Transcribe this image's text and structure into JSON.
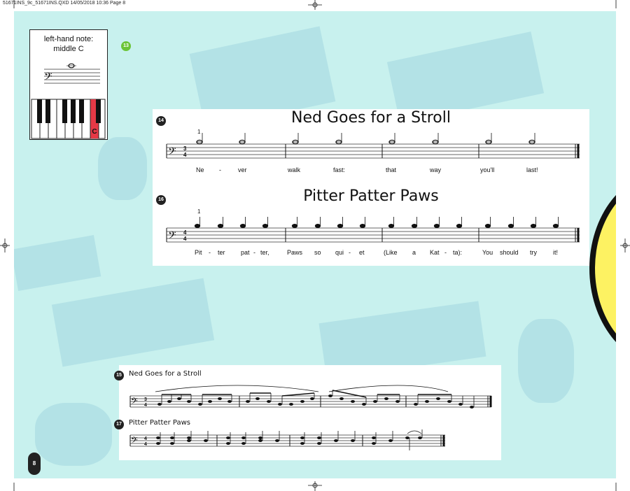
{
  "slug": "51671INS_9c_51671INS.QXD  14/05/2018  10:36  Page 8",
  "keybox": {
    "label_line1": "left-hand note:",
    "label_line2": "middle C",
    "key_letter": "C"
  },
  "badges": {
    "green": "13",
    "piece14": "14",
    "piece15": "15",
    "piece16": "16",
    "piece17": "17"
  },
  "piece1": {
    "title": "Ned Goes for a Stroll",
    "finger": "1",
    "lyrics": [
      "Ne",
      "-",
      "ver",
      "walk",
      "fast:",
      "that",
      "way",
      "you'll",
      "last!"
    ]
  },
  "piece2": {
    "title": "Pitter Patter Paws",
    "finger": "1",
    "lyrics": [
      "Pit",
      "-",
      "ter",
      "pat",
      "-",
      "ter,",
      "Paws",
      "so",
      "qui",
      "-",
      "et",
      "(Like",
      "a",
      "Kat",
      "-",
      "ta):",
      "You",
      "should",
      "try",
      "it!"
    ]
  },
  "exercise1": {
    "title": "Ned Goes for a Stroll"
  },
  "exercise2": {
    "title": "Pitter Patter Paws"
  },
  "page_number": "8",
  "colors": {
    "background": "#c8f1ee",
    "key_highlight": "#e63946",
    "badge_green": "#6bc437",
    "yellow": "#fdf262"
  }
}
